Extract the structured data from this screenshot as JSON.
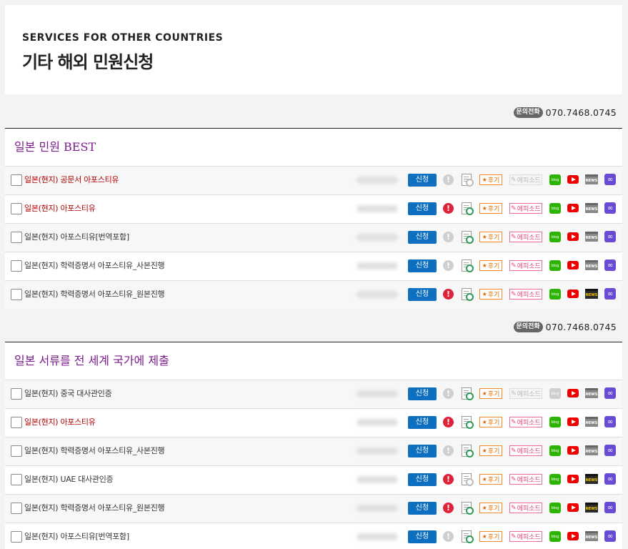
{
  "header": {
    "eyebrow": "SERVICES FOR OTHER COUNTRIES",
    "title": "기타 해외 민원신청"
  },
  "contact": {
    "label": "문의전화",
    "phone": "070.7468.0745"
  },
  "labels": {
    "apply": "신청",
    "warning_icon": "!",
    "review": "후기",
    "episode": "에피소드",
    "blog": "blog",
    "news": "NEWS",
    "link_icon": "∞"
  },
  "sections": [
    {
      "title": "일본 민원 BEST",
      "rows": [
        {
          "name": "일본(현지) 공문서 아포스티유",
          "highlight": true,
          "warning": false,
          "doc": false,
          "episode": false,
          "blog": true,
          "news": false
        },
        {
          "name": "일본(현지) 아포스티유",
          "highlight": true,
          "warning": true,
          "doc": true,
          "episode": true,
          "blog": true,
          "news": false
        },
        {
          "name": "일본(현지) 아포스티유[번역포함]",
          "highlight": false,
          "warning": false,
          "doc": true,
          "episode": true,
          "blog": true,
          "news": false
        },
        {
          "name": "일본(현지) 학력증명서 아포스티유_사본진행",
          "highlight": false,
          "warning": false,
          "doc": true,
          "episode": true,
          "blog": true,
          "news": false
        },
        {
          "name": "일본(현지) 학력증명서 아포스티유_원본진행",
          "highlight": false,
          "warning": true,
          "doc": true,
          "episode": true,
          "blog": true,
          "news": true
        }
      ]
    },
    {
      "title": "일본 서류를 전 세계 국가에 제출",
      "rows": [
        {
          "name": "일본(현지) 중국 대사관인증",
          "highlight": false,
          "warning": false,
          "doc": true,
          "episode": false,
          "blog": false,
          "news": false
        },
        {
          "name": "일본(현지) 아포스티유",
          "highlight": true,
          "warning": true,
          "doc": true,
          "episode": true,
          "blog": true,
          "news": false
        },
        {
          "name": "일본(현지) 학력증명서 아포스티유_사본진행",
          "highlight": false,
          "warning": false,
          "doc": true,
          "episode": true,
          "blog": true,
          "news": false
        },
        {
          "name": "일본(현지) UAE 대사관인증",
          "highlight": false,
          "warning": true,
          "doc": false,
          "episode": true,
          "blog": true,
          "news": true
        },
        {
          "name": "일본(현지) 학력증명서 아포스티유_원본진행",
          "highlight": false,
          "warning": true,
          "doc": true,
          "episode": true,
          "blog": true,
          "news": true
        },
        {
          "name": "일본(현지) 아포스티유[번역포함]",
          "highlight": false,
          "warning": false,
          "doc": true,
          "episode": true,
          "blog": true,
          "news": false
        }
      ]
    }
  ]
}
